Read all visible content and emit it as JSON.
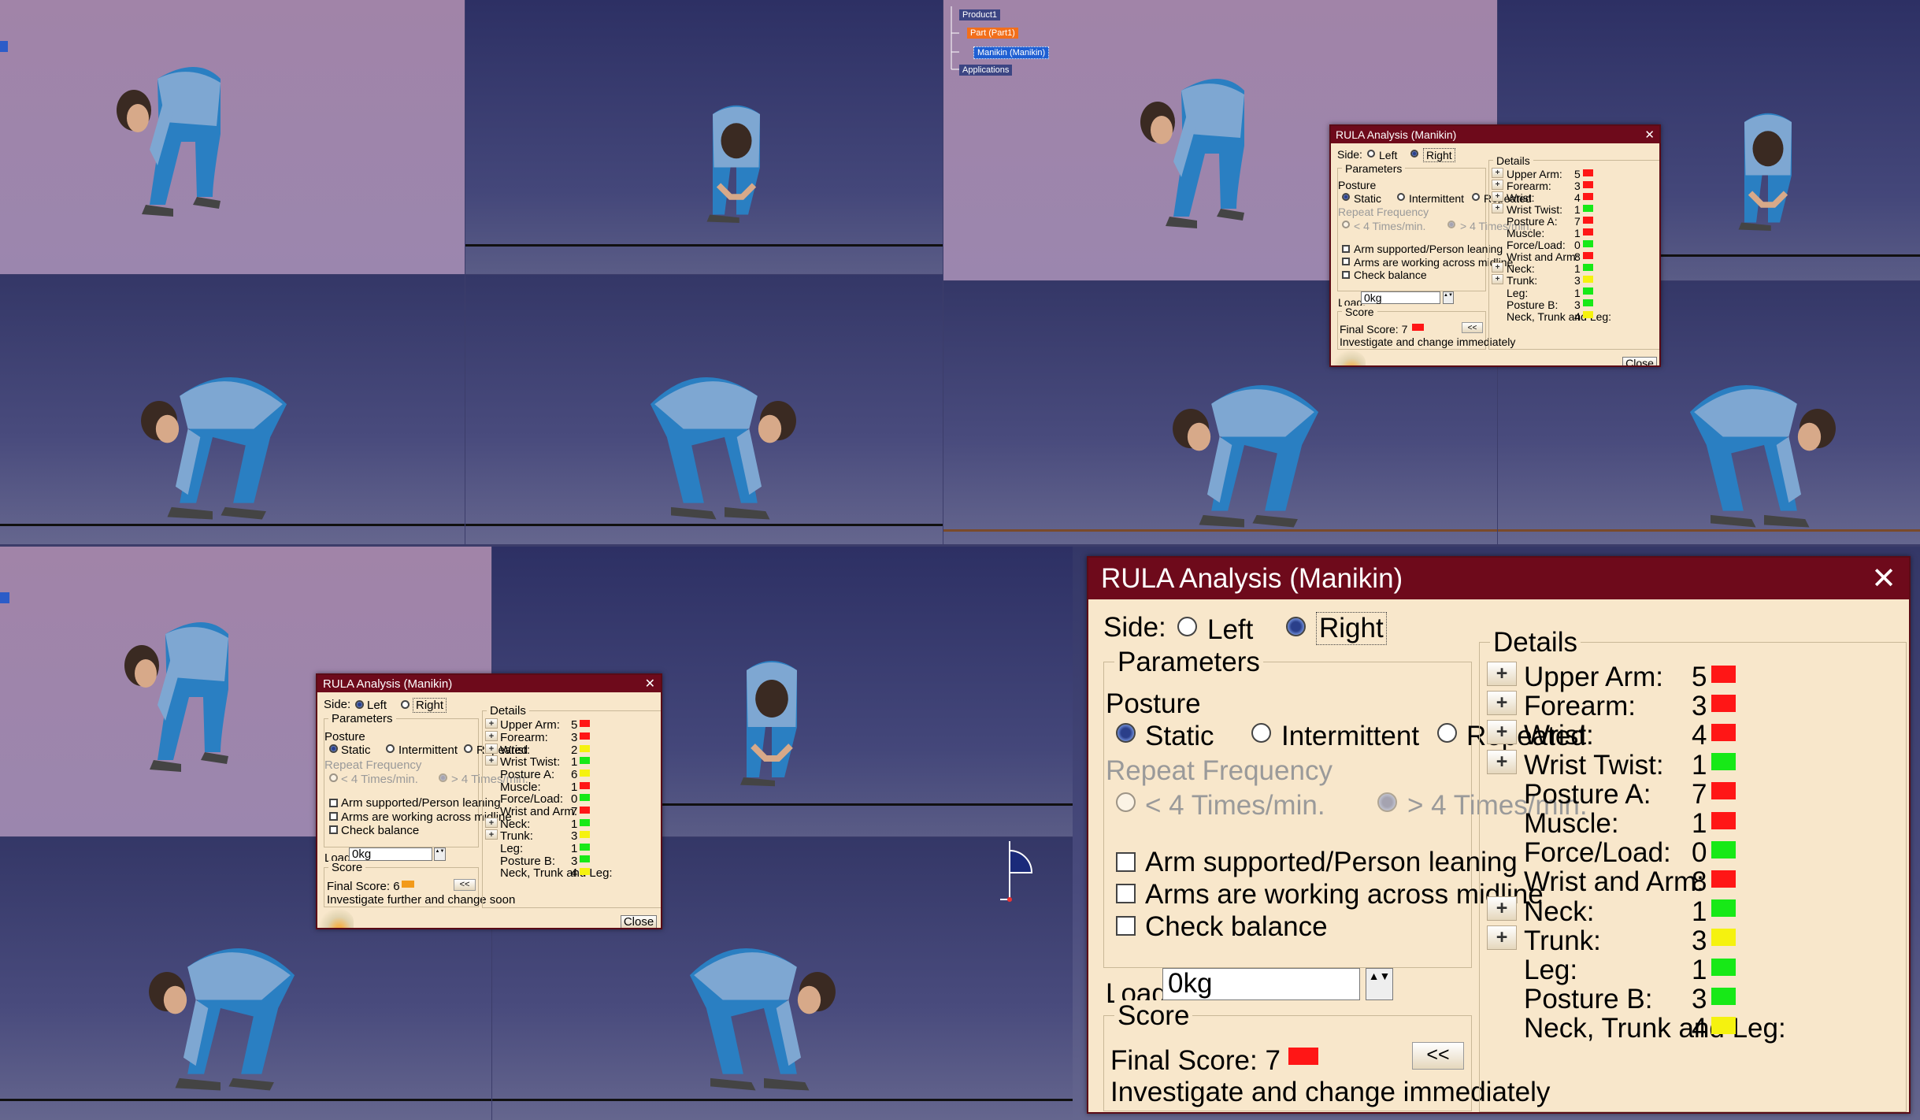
{
  "tree": {
    "root": "Product1",
    "part": "Part (Part1)",
    "manikin": "Manikin (Manikin)",
    "applications": "Applications"
  },
  "colors": {
    "red": "#ff1616",
    "green": "#17e917",
    "yellow": "#f5f20f",
    "orange": "#f29a1a",
    "title": "#6e0a1b"
  },
  "large_dialog": {
    "title": "RULA Analysis (Manikin)",
    "side_label": "Side:",
    "left": "Left",
    "right": "Right",
    "side_selected": "Right",
    "parameters": "Parameters",
    "posture": "Posture",
    "static": "Static",
    "intermittent": "Intermittent",
    "repeated": "Repeated",
    "posture_selected": "Static",
    "repeat_frequency": "Repeat Frequency",
    "freq_lt": "< 4 Times/min.",
    "freq_gt": "> 4 Times/min.",
    "arm_supported": "Arm supported/Person leaning",
    "arms_midline": "Arms are working across midline",
    "check_balance": "Check balance",
    "load_label": "Load:",
    "load_value": "0kg",
    "score": "Score",
    "final_score": "Final Score: 7",
    "final_color": "red",
    "advice": "Investigate and change immediately",
    "collapse": "<<",
    "details": "Details",
    "close": "Close",
    "rows": [
      {
        "label": "Upper Arm:",
        "value": "5",
        "color": "red",
        "plus": true
      },
      {
        "label": "Forearm:",
        "value": "3",
        "color": "red",
        "plus": true
      },
      {
        "label": "Wrist:",
        "value": "4",
        "color": "red",
        "plus": true
      },
      {
        "label": "Wrist Twist:",
        "value": "1",
        "color": "green",
        "plus": true
      },
      {
        "label": "Posture A:",
        "value": "7",
        "color": "red",
        "plus": false
      },
      {
        "label": "Muscle:",
        "value": "1",
        "color": "red",
        "plus": false
      },
      {
        "label": "Force/Load:",
        "value": "0",
        "color": "green",
        "plus": false
      },
      {
        "label": "Wrist and Arm:",
        "value": "8",
        "color": "red",
        "plus": false
      },
      {
        "label": "Neck:",
        "value": "1",
        "color": "green",
        "plus": true
      },
      {
        "label": "Trunk:",
        "value": "3",
        "color": "yellow",
        "plus": true
      },
      {
        "label": "Leg:",
        "value": "1",
        "color": "green",
        "plus": false
      },
      {
        "label": "Posture B:",
        "value": "3",
        "color": "green",
        "plus": false
      },
      {
        "label": "Neck, Trunk and Leg:",
        "value": "4",
        "color": "yellow",
        "plus": false
      }
    ]
  },
  "mid_dialog": {
    "title": "RULA Analysis (Manikin)",
    "side_label": "Side:",
    "left": "Left",
    "right": "Right",
    "side_selected": "Right",
    "parameters": "Parameters",
    "posture": "Posture",
    "static": "Static",
    "intermittent": "Intermittent",
    "repeated": "Repeated",
    "repeat_frequency": "Repeat Frequency",
    "freq_lt": "< 4 Times/min.",
    "freq_gt": "> 4 Times/min.",
    "arm_supported": "Arm supported/Person leaning",
    "arms_midline": "Arms are working across midline",
    "check_balance": "Check balance",
    "load_label": "Load:",
    "load_value": "0kg",
    "score": "Score",
    "final_score": "Final Score: 7",
    "final_color": "red",
    "advice": "Investigate and change immediately",
    "collapse": "<<",
    "details": "Details",
    "close": "Close",
    "rows": [
      {
        "label": "Upper Arm:",
        "value": "5",
        "color": "red",
        "plus": true
      },
      {
        "label": "Forearm:",
        "value": "3",
        "color": "red",
        "plus": true
      },
      {
        "label": "Wrist:",
        "value": "4",
        "color": "red",
        "plus": true
      },
      {
        "label": "Wrist Twist:",
        "value": "1",
        "color": "green",
        "plus": true
      },
      {
        "label": "Posture A:",
        "value": "7",
        "color": "red",
        "plus": false
      },
      {
        "label": "Muscle:",
        "value": "1",
        "color": "red",
        "plus": false
      },
      {
        "label": "Force/Load:",
        "value": "0",
        "color": "green",
        "plus": false
      },
      {
        "label": "Wrist and Arm:",
        "value": "8",
        "color": "red",
        "plus": false
      },
      {
        "label": "Neck:",
        "value": "1",
        "color": "green",
        "plus": true
      },
      {
        "label": "Trunk:",
        "value": "3",
        "color": "yellow",
        "plus": true
      },
      {
        "label": "Leg:",
        "value": "1",
        "color": "green",
        "plus": false
      },
      {
        "label": "Posture B:",
        "value": "3",
        "color": "green",
        "plus": false
      },
      {
        "label": "Neck, Trunk and Leg:",
        "value": "4",
        "color": "yellow",
        "plus": false
      }
    ]
  },
  "small_dialog": {
    "title": "RULA Analysis (Manikin)",
    "side_label": "Side:",
    "left": "Left",
    "right": "Right",
    "side_selected": "Left",
    "parameters": "Parameters",
    "posture": "Posture",
    "static": "Static",
    "intermittent": "Intermittent",
    "repeated": "Repeated",
    "repeat_frequency": "Repeat Frequency",
    "freq_lt": "< 4 Times/min.",
    "freq_gt": "> 4 Times/min.",
    "arm_supported": "Arm supported/Person leaning",
    "arms_midline": "Arms are working across midline",
    "check_balance": "Check balance",
    "load_label": "Load:",
    "load_value": "0kg",
    "score": "Score",
    "final_score": "Final Score: 6",
    "final_color": "orange",
    "advice": "Investigate further and change soon",
    "collapse": "<<",
    "details": "Details",
    "close": "Close",
    "rows": [
      {
        "label": "Upper Arm:",
        "value": "5",
        "color": "red",
        "plus": true
      },
      {
        "label": "Forearm:",
        "value": "3",
        "color": "red",
        "plus": true
      },
      {
        "label": "Wrist:",
        "value": "2",
        "color": "yellow",
        "plus": true
      },
      {
        "label": "Wrist Twist:",
        "value": "1",
        "color": "green",
        "plus": true
      },
      {
        "label": "Posture A:",
        "value": "6",
        "color": "yellow",
        "plus": false
      },
      {
        "label": "Muscle:",
        "value": "1",
        "color": "red",
        "plus": false
      },
      {
        "label": "Force/Load:",
        "value": "0",
        "color": "green",
        "plus": false
      },
      {
        "label": "Wrist and Arm:",
        "value": "7",
        "color": "red",
        "plus": false
      },
      {
        "label": "Neck:",
        "value": "1",
        "color": "green",
        "plus": true
      },
      {
        "label": "Trunk:",
        "value": "3",
        "color": "yellow",
        "plus": true
      },
      {
        "label": "Leg:",
        "value": "1",
        "color": "green",
        "plus": false
      },
      {
        "label": "Posture B:",
        "value": "3",
        "color": "green",
        "plus": false
      },
      {
        "label": "Neck, Trunk and Leg:",
        "value": "4",
        "color": "yellow",
        "plus": false
      }
    ]
  }
}
